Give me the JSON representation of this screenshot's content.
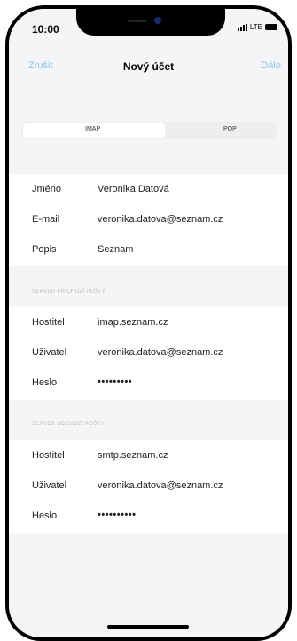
{
  "status": {
    "time": "10:00",
    "network": "LTE"
  },
  "nav": {
    "cancel": "Zrušit",
    "title": "Nový účet",
    "next": "Dále"
  },
  "segment": {
    "options": [
      "IMAP",
      "POP"
    ],
    "selected": "IMAP"
  },
  "account": {
    "rows": [
      {
        "label": "Jméno",
        "value": "Veronika Datová"
      },
      {
        "label": "E-mail",
        "value": "veronika.datova@seznam.cz"
      },
      {
        "label": "Popis",
        "value": "Seznam"
      }
    ]
  },
  "incoming": {
    "header": "SERVER PŘÍCHOZÍ POŠTY",
    "rows": [
      {
        "label": "Hostitel",
        "value": "imap.seznam.cz"
      },
      {
        "label": "Uživatel",
        "value": "veronika.datova@seznam.cz"
      },
      {
        "label": "Heslo",
        "value": "•••••••••"
      }
    ]
  },
  "outgoing": {
    "header": "SERVER ODCHOZÍ POŠTY",
    "rows": [
      {
        "label": "Hostitel",
        "value": "smtp.seznam.cz"
      },
      {
        "label": "Uživatel",
        "value": "veronika.datova@seznam.cz"
      },
      {
        "label": "Heslo",
        "value": "••••••••••"
      }
    ]
  },
  "colors": {
    "accent": "#8ec6ef",
    "background": "#f5f5f7"
  }
}
